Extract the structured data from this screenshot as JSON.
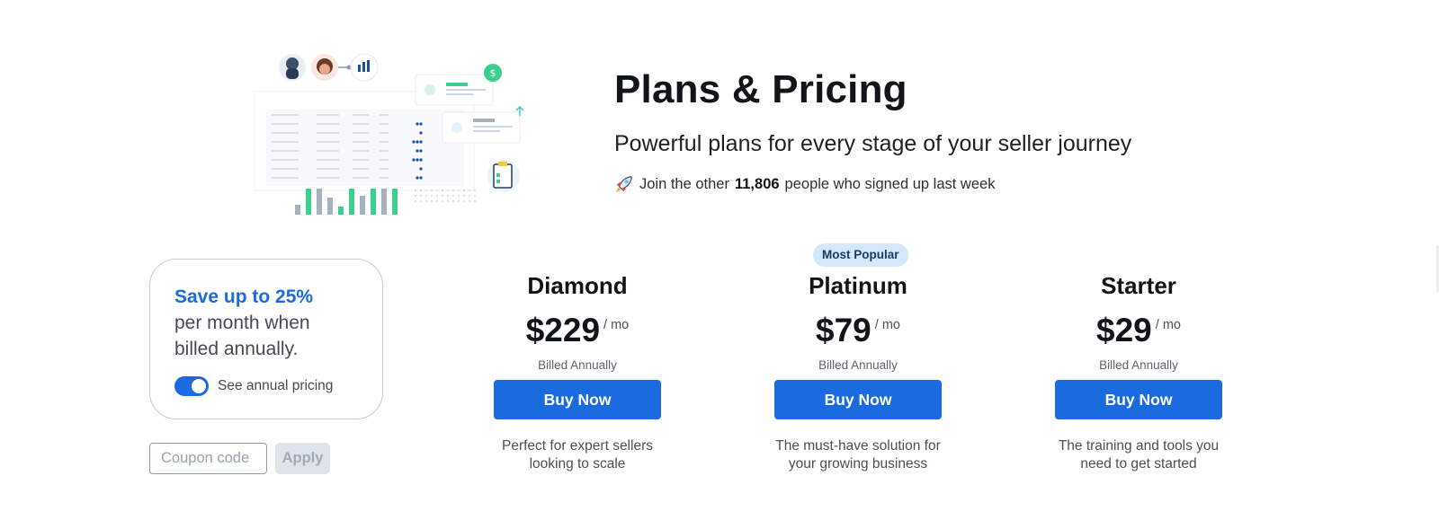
{
  "hero": {
    "title": "Plans & Pricing",
    "subtitle": "Powerful plans for every stage of your seller journey",
    "social_prefix": "Join the other",
    "social_count": "11,806",
    "social_suffix": "people who signed up last week",
    "rocket_icon": "rocket-icon"
  },
  "savings": {
    "headline": "Save up to 25%",
    "body": "per month when billed annually.",
    "toggle_label": "See annual pricing",
    "toggle_on": true
  },
  "coupon": {
    "placeholder": "Coupon code",
    "apply_label": "Apply"
  },
  "badge": "Most Popular",
  "plans": [
    {
      "name": "Diamond",
      "price": "$229",
      "unit": "/ mo",
      "billed": "Billed Annually",
      "cta": "Buy Now",
      "description": "Perfect for expert sellers looking to scale"
    },
    {
      "name": "Platinum",
      "price": "$79",
      "unit": "/ mo",
      "billed": "Billed Annually",
      "cta": "Buy Now",
      "description": "The must-have solution for your growing business"
    },
    {
      "name": "Starter",
      "price": "$29",
      "unit": "/ mo",
      "billed": "Billed Annually",
      "cta": "Buy Now",
      "description": "The training and tools you need to get started"
    }
  ],
  "colors": {
    "accent": "#1a6be0",
    "badge_bg": "#d5e8fb",
    "bar_green": "#3ecf8e",
    "bar_gray": "#a7b0bd"
  }
}
